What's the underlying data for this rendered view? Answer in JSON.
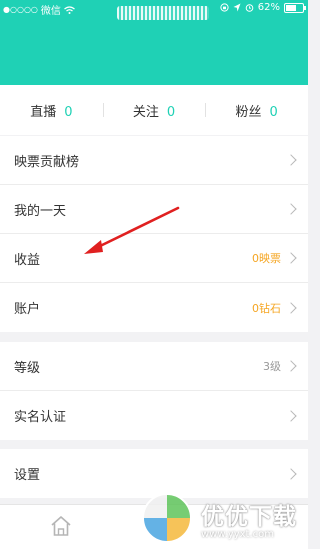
{
  "status_bar": {
    "carrier": "微信",
    "battery": "62%",
    "battery_level": 0.62
  },
  "stats": [
    {
      "label": "直播",
      "count": "0"
    },
    {
      "label": "关注",
      "count": "0"
    },
    {
      "label": "粉丝",
      "count": "0"
    }
  ],
  "menu": {
    "group1": [
      {
        "label": "映票贡献榜",
        "value": ""
      },
      {
        "label": "我的一天",
        "value": ""
      },
      {
        "label": "收益",
        "value": "0映票"
      },
      {
        "label": "账户",
        "value": "0钻石"
      }
    ],
    "group2": [
      {
        "label": "等级",
        "value": "3级"
      },
      {
        "label": "实名认证",
        "value": ""
      }
    ],
    "group3": [
      {
        "label": "设置",
        "value": ""
      }
    ]
  },
  "watermark": {
    "title": "优优下载",
    "url": "www.yyxt.com"
  },
  "colors": {
    "accent": "#1fd1b5",
    "value_orange": "#f5a623",
    "arrow_red": "#e02020"
  },
  "icons": {
    "tab_home": "home-icon",
    "annotation": "red-arrow"
  }
}
